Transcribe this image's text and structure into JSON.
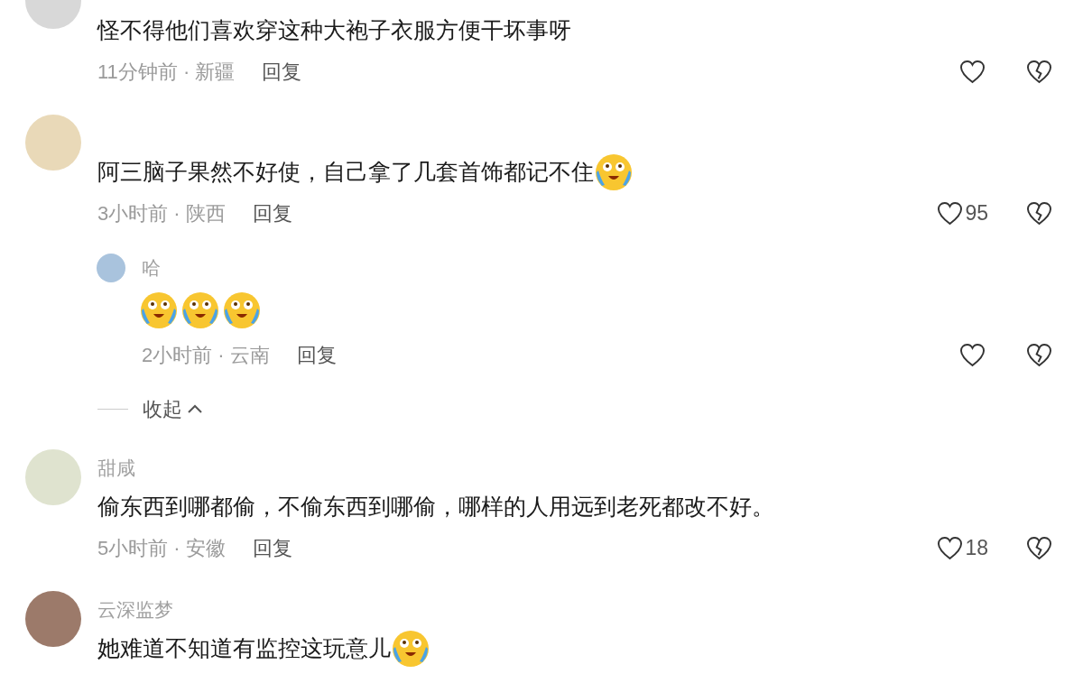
{
  "comments": [
    {
      "content": [
        {
          "kind": "text",
          "text": "怪不得他们喜欢穿这种大袍子衣服方便干坏事呀"
        }
      ],
      "time_location": "11分钟前 · 新疆",
      "reply_label": "回复"
    },
    {
      "content": [
        {
          "kind": "text",
          "text": "阿三脑子果然不好使，自己拿了几套首饰都记不住"
        },
        {
          "kind": "emoji"
        }
      ],
      "time_location": "3小时前 · 陕西",
      "reply_label": "回复",
      "like_count": "95",
      "replies": [
        {
          "author": "哈",
          "content": [
            {
              "kind": "emoji"
            },
            {
              "kind": "emoji"
            },
            {
              "kind": "emoji"
            }
          ],
          "time_location": "2小时前 · 云南",
          "reply_label": "回复"
        }
      ],
      "collapse_label": "收起"
    },
    {
      "author": "甜咸",
      "content": [
        {
          "kind": "text",
          "text": "偷东西到哪都偷，不偷东西到哪偷，哪样的人用远到老死都改不好。"
        }
      ],
      "time_location": "5小时前 · 安徽",
      "reply_label": "回复",
      "like_count": "18"
    },
    {
      "author": "云深监梦",
      "content": [
        {
          "kind": "text",
          "text": "她难道不知道有监控这玩意儿"
        },
        {
          "kind": "emoji"
        }
      ]
    }
  ]
}
